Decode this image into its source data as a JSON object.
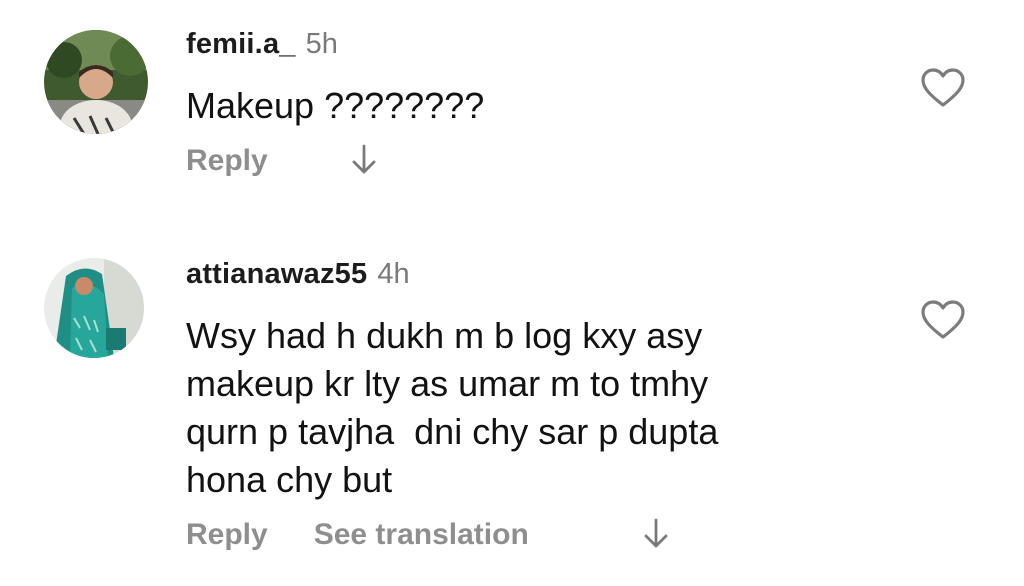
{
  "comments": [
    {
      "username": "femii.a_",
      "time": "5h",
      "lines": [
        "Makeup ????????"
      ],
      "reply_label": "Reply",
      "avatar_icon": "profile-photo",
      "like_icon": "heart-outline-icon",
      "more_icon": "arrow-down-icon"
    },
    {
      "username": "attianawaz55",
      "time": "4h",
      "lines": [
        "Wsy had h dukh m b log kxy asy",
        "makeup kr lty as umar m to tmhy",
        "qurn p tavjha  dni chy sar p dupta",
        "hona chy but"
      ],
      "reply_label": "Reply",
      "translation_label": "See translation",
      "avatar_icon": "profile-photo",
      "like_icon": "heart-outline-icon",
      "more_icon": "arrow-down-icon"
    }
  ],
  "colors": {
    "username": "#1c1c1c",
    "meta": "#8e8e8e",
    "text": "#121212",
    "background": "#ffffff"
  }
}
